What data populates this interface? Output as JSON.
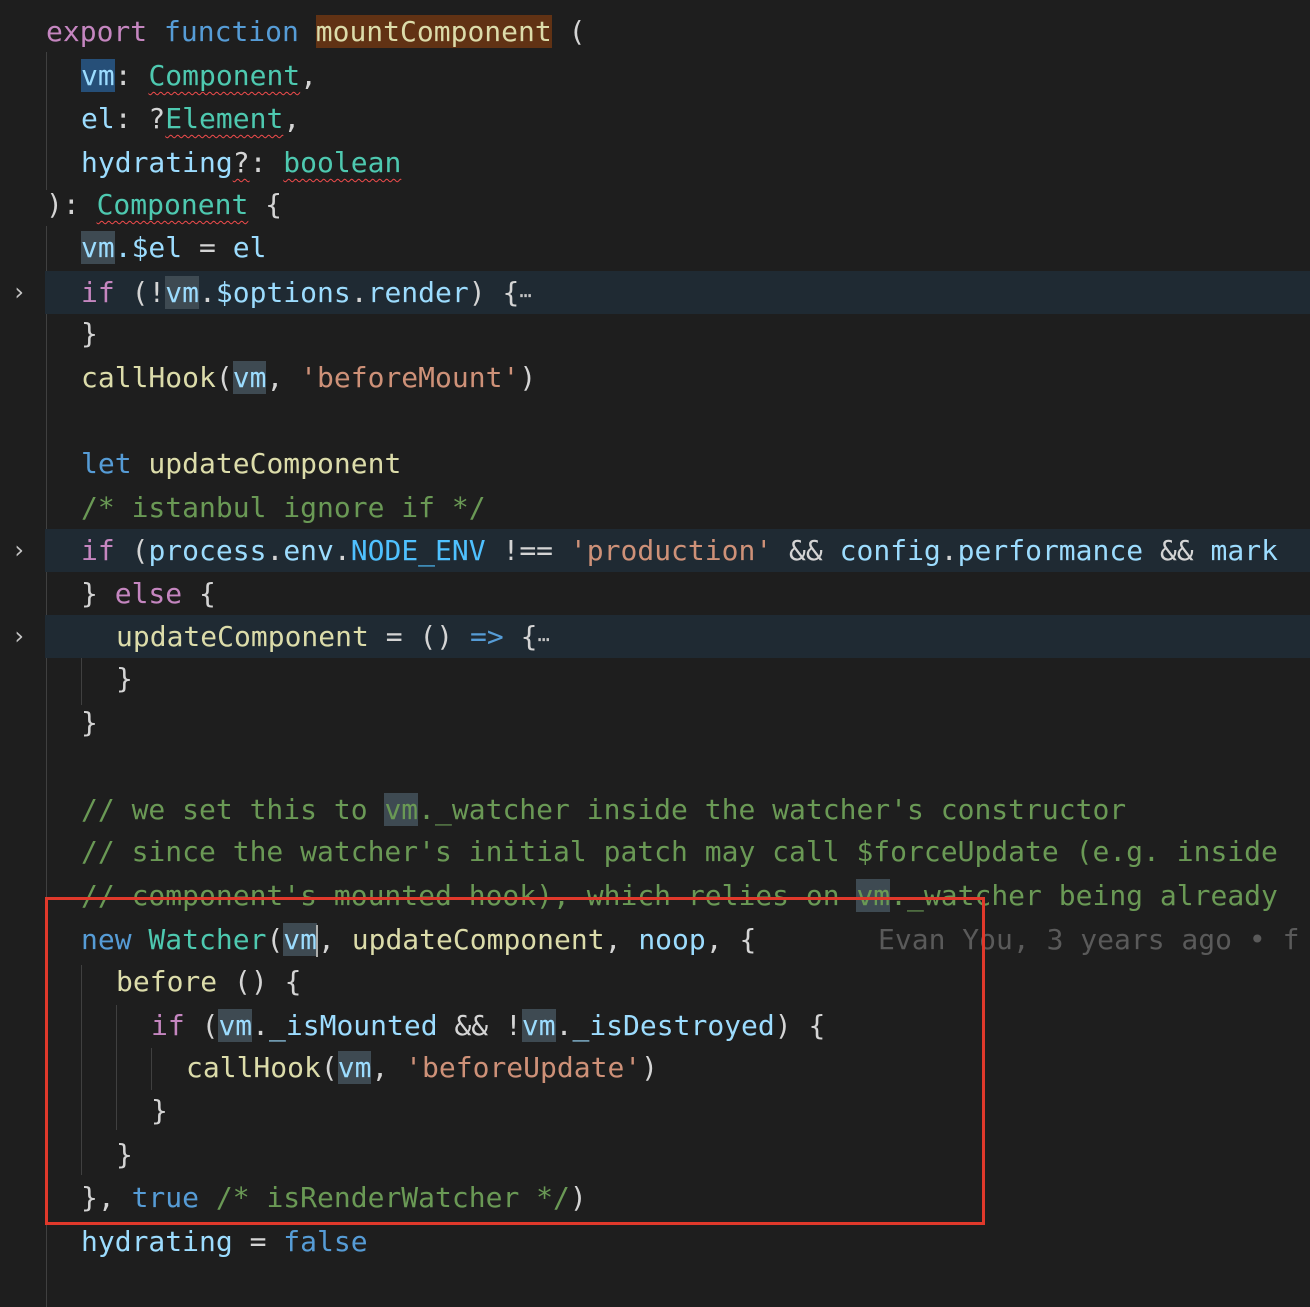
{
  "code": {
    "l1_export": "export",
    "l1_function": "function",
    "l1_name": "mountComponent",
    "l1_paren": " (",
    "l2_vm": "vm",
    "l2_colon": ": ",
    "l2_type": "Component",
    "l2_comma": ",",
    "l3_el": "el",
    "l3_colon": ": ?",
    "l3_type": "Element",
    "l3_comma": ",",
    "l4_hydrating": "hydrating",
    "l4_q": "?",
    "l4_colon": ": ",
    "l4_type": "boolean",
    "l5_close": "): ",
    "l5_type": "Component",
    "l5_brace": " {",
    "l6_vm": "vm",
    "l6_rest": ".$el",
    "l6_eq": " = ",
    "l6_el": "el",
    "l7_if": "if",
    "l7_open": " (!",
    "l7_vm": "vm",
    "l7_dot": ".",
    "l7_options": "$options",
    "l7_dot2": ".",
    "l7_render": "render",
    "l7_close": ") {",
    "l7_ellipsis": "⋯",
    "l8_brace": "}",
    "l9_callhook": "callHook",
    "l9_open": "(",
    "l9_vm": "vm",
    "l9_comma": ", ",
    "l9_str": "'beforeMount'",
    "l9_close": ")",
    "l11_let": "let",
    "l11_name": " updateComponent",
    "l12_comment": "/* istanbul ignore if */",
    "l13_if": "if",
    "l13_open": " (",
    "l13_process": "process",
    "l13_dot1": ".",
    "l13_env": "env",
    "l13_dot2": ".",
    "l13_node": "NODE_ENV",
    "l13_neq": " !== ",
    "l13_str": "'production'",
    "l13_and": " && ",
    "l13_config": "config",
    "l13_dot3": ".",
    "l13_perf": "performance",
    "l13_and2": " && ",
    "l13_mark": "mark",
    "l14_brace": "} ",
    "l14_else": "else",
    "l14_open": " {",
    "l15_name": "updateComponent",
    "l15_eq": " = () ",
    "l15_arrow": "=>",
    "l15_brace": " {",
    "l15_ellipsis": "⋯",
    "l16_brace": "}",
    "l17_brace": "}",
    "l19_cmt_a": "// we set this to ",
    "l19_vm": "vm",
    "l19_cmt_b": "._watcher inside the watcher's constructor",
    "l20_cmt": "// since the watcher's initial patch may call $forceUpdate (e.g. inside",
    "l21_cmt_a": "// component's mounted hook), which relies on ",
    "l21_vm": "vm",
    "l21_cmt_b": "._watcher being already",
    "l22_new": "new",
    "l22_watcher": " Watcher",
    "l22_open": "(",
    "l22_vm": "vm",
    "l22_args_a": ", ",
    "l22_update": "updateComponent",
    "l22_comma": ", ",
    "l22_noop": "noop",
    "l22_brace": ", {",
    "l22_blame": "Evan You, 3 years ago • f",
    "l23_before": "before",
    "l23_rest": " () {",
    "l24_if": "if",
    "l24_open": " (",
    "l24_vm": "vm",
    "l24_dot": ".",
    "l24_mounted": "_isMounted",
    "l24_and": " && !",
    "l24_vm2": "vm",
    "l24_dot2": ".",
    "l24_destroyed": "_isDestroyed",
    "l24_close": ") {",
    "l25_callhook": "callHook",
    "l25_open": "(",
    "l25_vm": "vm",
    "l25_comma": ", ",
    "l25_str": "'beforeUpdate'",
    "l25_close": ")",
    "l26_brace": "}",
    "l27_brace": "}",
    "l28_close": "}, ",
    "l28_true": "true",
    "l28_cmt": " /* isRenderWatcher */",
    "l28_paren": ")",
    "l29_hydrating": "hydrating",
    "l29_eq": " = ",
    "l29_false": "false"
  },
  "fold_icons": {
    "chevron": "›"
  },
  "colors": {
    "background": "#1e1e1e",
    "folded_line": "#1f2a33",
    "highlight_box": "#e0392b",
    "keyword": "#569cd6",
    "control_keyword": "#c586c0",
    "function": "#dcdcaa",
    "type": "#4ec9b0",
    "variable": "#9cdcfe",
    "string": "#ce9178",
    "comment": "#6a9955"
  }
}
